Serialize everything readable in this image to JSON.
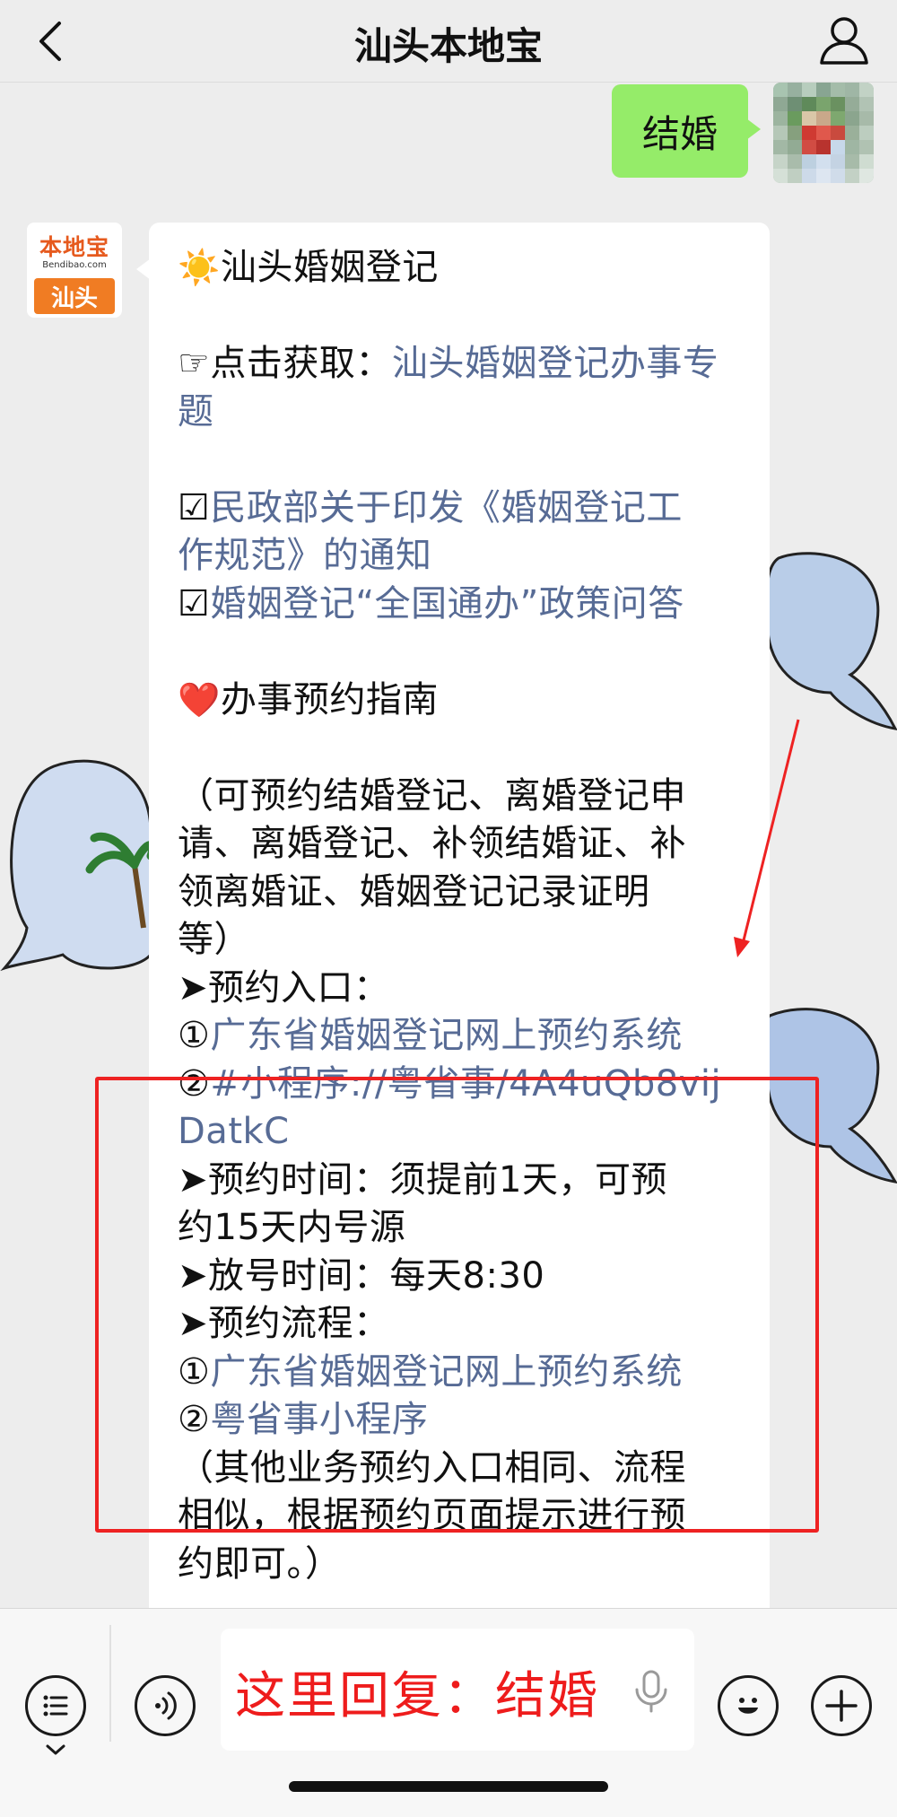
{
  "header": {
    "title": "汕头本地宝"
  },
  "user_message": {
    "text": "结婚"
  },
  "bot": {
    "logo_top": "本地宝",
    "logo_url": "Bendibao.com",
    "logo_city": "汕头"
  },
  "bot_message": {
    "l1_icon": "☀️",
    "l1_text": "汕头婚姻登记",
    "l2_prefix": "☞点击获取：",
    "l2_link_a": "汕头婚姻登记办事专",
    "l3_link_b": "题",
    "l4_icon": "☑",
    "l4_link": "民政部关于印发《婚姻登记工",
    "l5_link": "作规范》的通知",
    "l6_icon": "☑",
    "l6_link": "婚姻登记“全国通办”政策问答",
    "l7_icon": "❤️",
    "l7_text": "办事预约指南",
    "l8": "（可预约结婚登记、离婚登记申",
    "l9": "请、离婚登记、补领结婚证、补",
    "l10": "领离婚证、婚姻登记记录证明",
    "l11": "等）",
    "l12": "➤预约入口：",
    "l13_num": "①",
    "l13_link": "广东省婚姻登记网上预约系统",
    "l14_num": "②",
    "l14_link": "#小程序://粤省事/4A4uQb8vij",
    "l15_link": "DatkC",
    "l16": "➤预约时间：须提前1天，可预",
    "l17": "约15天内号源",
    "l18": "➤放号时间：每天8:30",
    "l19": "➤预约流程：",
    "l20_num": "①",
    "l20_link": "广东省婚姻登记网上预约系统",
    "l21_num": "②",
    "l21_link": "粤省事小程序",
    "l22": "（其他业务预约入口相同、流程",
    "l23": "相似，根据预约页面提示进行预",
    "l24": "约即可。）"
  },
  "input": {
    "text": "这里回复：结婚"
  },
  "icons": {
    "back": "chevron-left-icon",
    "profile": "person-icon",
    "menu": "list-icon",
    "voice": "voice-icon",
    "mic": "microphone-icon",
    "emoji": "smiley-icon",
    "plus": "plus-icon"
  },
  "colors": {
    "background": "#ededed",
    "user_bubble": "#95ec69",
    "link": "#576b95",
    "annotation_red": "#ee2222",
    "logo_orange": "#f07c23"
  }
}
